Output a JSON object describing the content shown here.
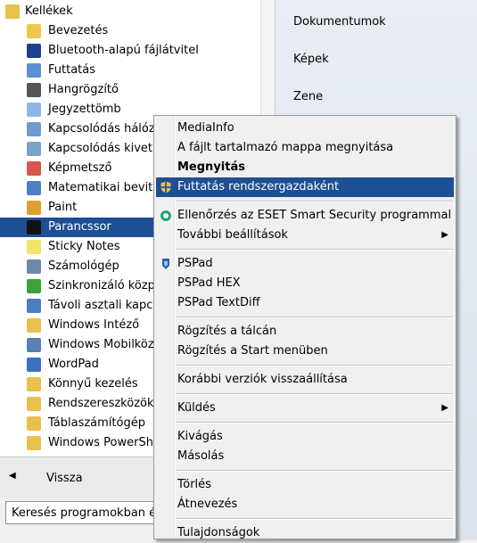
{
  "programs": {
    "folder_header": "Kellékek",
    "items": [
      {
        "label": "Bevezetés",
        "icon": "intro-icon"
      },
      {
        "label": "Bluetooth-alapú fájlátvitel",
        "icon": "bluetooth-icon"
      },
      {
        "label": "Futtatás",
        "icon": "run-icon"
      },
      {
        "label": "Hangrögzítő",
        "icon": "microphone-icon"
      },
      {
        "label": "Jegyzettömb",
        "icon": "notepad-icon"
      },
      {
        "label": "Kapcsolódás hálóza",
        "icon": "network-projector-icon"
      },
      {
        "label": "Kapcsolódás kivetít",
        "icon": "projector-icon"
      },
      {
        "label": "Képmetsző",
        "icon": "scissors-icon"
      },
      {
        "label": "Matematikai bevitel",
        "icon": "math-input-icon"
      },
      {
        "label": "Paint",
        "icon": "paint-icon"
      },
      {
        "label": "Parancssor",
        "icon": "cmd-icon",
        "selected": true
      },
      {
        "label": "Sticky Notes",
        "icon": "sticky-notes-icon"
      },
      {
        "label": "Számológép",
        "icon": "calculator-icon"
      },
      {
        "label": "Szinkronizáló közpo",
        "icon": "sync-icon"
      },
      {
        "label": "Távoli asztali kapcs",
        "icon": "remote-desktop-icon"
      },
      {
        "label": "Windows Intéző",
        "icon": "explorer-icon"
      },
      {
        "label": "Windows Mobilközp",
        "icon": "mobility-icon"
      },
      {
        "label": "WordPad",
        "icon": "wordpad-icon"
      },
      {
        "label": "Könnyű kezelés",
        "icon": "folder-icon"
      },
      {
        "label": "Rendszereszközök",
        "icon": "folder-icon"
      },
      {
        "label": "Táblaszámítógép",
        "icon": "folder-icon"
      },
      {
        "label": "Windows PowerShe",
        "icon": "folder-icon"
      }
    ]
  },
  "back": {
    "label": "Vissza"
  },
  "search": {
    "text": "Keresés programokban és"
  },
  "right_pane": {
    "items": [
      "Dokumentumok",
      "Képek",
      "Zene"
    ]
  },
  "context_menu": {
    "groups": [
      [
        {
          "label": "MediaInfo"
        },
        {
          "label": "A fájlt tartalmazó mappa megnyitása"
        },
        {
          "label": "Megnyitás",
          "bold": true
        },
        {
          "label": "Futtatás rendszergazdaként",
          "highlighted": true,
          "icon": "shield-icon"
        }
      ],
      [
        {
          "label": "Ellenőrzés az ESET Smart Security programmal",
          "icon": "eset-icon"
        },
        {
          "label": "További beállítások",
          "submenu": true
        }
      ],
      [
        {
          "label": "PSPad",
          "icon": "pspad-icon"
        },
        {
          "label": "PSPad HEX"
        },
        {
          "label": "PSPad TextDiff"
        }
      ],
      [
        {
          "label": "Rögzítés a tálcán"
        },
        {
          "label": "Rögzítés a Start menüben"
        }
      ],
      [
        {
          "label": "Korábbi verziók visszaállítása"
        }
      ],
      [
        {
          "label": "Küldés",
          "submenu": true
        }
      ],
      [
        {
          "label": "Kivágás"
        },
        {
          "label": "Másolás"
        }
      ],
      [
        {
          "label": "Törlés"
        },
        {
          "label": "Átnevezés"
        }
      ],
      [
        {
          "label": "Tulajdonságok"
        }
      ]
    ]
  },
  "colors": {
    "selection": "#1d4f94",
    "menu_bg": "#f0f0f0"
  }
}
